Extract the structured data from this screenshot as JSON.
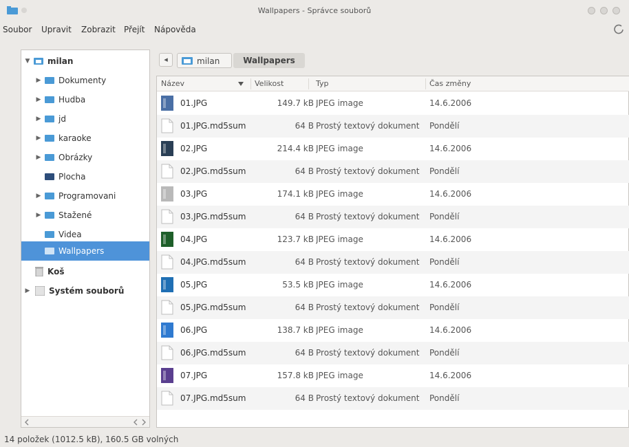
{
  "window": {
    "title": "Wallpapers - Správce souborů"
  },
  "menu": {
    "items": [
      {
        "label": "Soubor"
      },
      {
        "label": "Upravit"
      },
      {
        "label": "Zobrazit"
      },
      {
        "label": "Přejít"
      },
      {
        "label": "Nápověda"
      }
    ]
  },
  "sidebar": {
    "root": "milan",
    "items": [
      {
        "label": "Dokumenty"
      },
      {
        "label": "Hudba"
      },
      {
        "label": "jd"
      },
      {
        "label": "karaoke"
      },
      {
        "label": "Obrázky"
      },
      {
        "label": "Plocha"
      },
      {
        "label": "Programovani"
      },
      {
        "label": "Stažené"
      },
      {
        "label": "Videa"
      },
      {
        "label": "Wallpapers"
      }
    ],
    "trash": "Koš",
    "filesystem": "Systém souborů"
  },
  "breadcrumb": {
    "home": "milan",
    "current": "Wallpapers"
  },
  "columns": {
    "name": "Název",
    "size": "Velikost",
    "type": "Typ",
    "date": "Čas změny"
  },
  "files": [
    {
      "name": "01.JPG",
      "size": "149.7 kB",
      "type": "JPEG image",
      "date": "14.6.2006",
      "icon": "image-thumbnail-icon",
      "color": "#4a6fa5"
    },
    {
      "name": "01.JPG.md5sum",
      "size": "64 B",
      "type": "Prostý textový dokument",
      "date": "Pondělí",
      "icon": "text-file-icon"
    },
    {
      "name": "02.JPG",
      "size": "214.4 kB",
      "type": "JPEG image",
      "date": "14.6.2006",
      "icon": "image-thumbnail-icon",
      "color": "#2a3f55"
    },
    {
      "name": "02.JPG.md5sum",
      "size": "64 B",
      "type": "Prostý textový dokument",
      "date": "Pondělí",
      "icon": "text-file-icon"
    },
    {
      "name": "03.JPG",
      "size": "174.1 kB",
      "type": "JPEG image",
      "date": "14.6.2006",
      "icon": "image-thumbnail-icon",
      "color": "#b9b9b9"
    },
    {
      "name": "03.JPG.md5sum",
      "size": "64 B",
      "type": "Prostý textový dokument",
      "date": "Pondělí",
      "icon": "text-file-icon"
    },
    {
      "name": "04.JPG",
      "size": "123.7 kB",
      "type": "JPEG image",
      "date": "14.6.2006",
      "icon": "image-thumbnail-icon",
      "color": "#1e5f2a"
    },
    {
      "name": "04.JPG.md5sum",
      "size": "64 B",
      "type": "Prostý textový dokument",
      "date": "Pondělí",
      "icon": "text-file-icon"
    },
    {
      "name": "05.JPG",
      "size": "53.5 kB",
      "type": "JPEG image",
      "date": "14.6.2006",
      "icon": "image-thumbnail-icon",
      "color": "#1f6fb4"
    },
    {
      "name": "05.JPG.md5sum",
      "size": "64 B",
      "type": "Prostý textový dokument",
      "date": "Pondělí",
      "icon": "text-file-icon"
    },
    {
      "name": "06.JPG",
      "size": "138.7 kB",
      "type": "JPEG image",
      "date": "14.6.2006",
      "icon": "image-thumbnail-icon",
      "color": "#2f7ad0"
    },
    {
      "name": "06.JPG.md5sum",
      "size": "64 B",
      "type": "Prostý textový dokument",
      "date": "Pondělí",
      "icon": "text-file-icon"
    },
    {
      "name": "07.JPG",
      "size": "157.8 kB",
      "type": "JPEG image",
      "date": "14.6.2006",
      "icon": "image-thumbnail-icon",
      "color": "#5a3f8f"
    },
    {
      "name": "07.JPG.md5sum",
      "size": "64 B",
      "type": "Prostý textový dokument",
      "date": "Pondělí",
      "icon": "text-file-icon"
    }
  ],
  "status": "14 položek (1012.5 kB), 160.5 GB volných",
  "colors": {
    "selection": "#4e93d9",
    "folder": "#4a9ad6"
  }
}
